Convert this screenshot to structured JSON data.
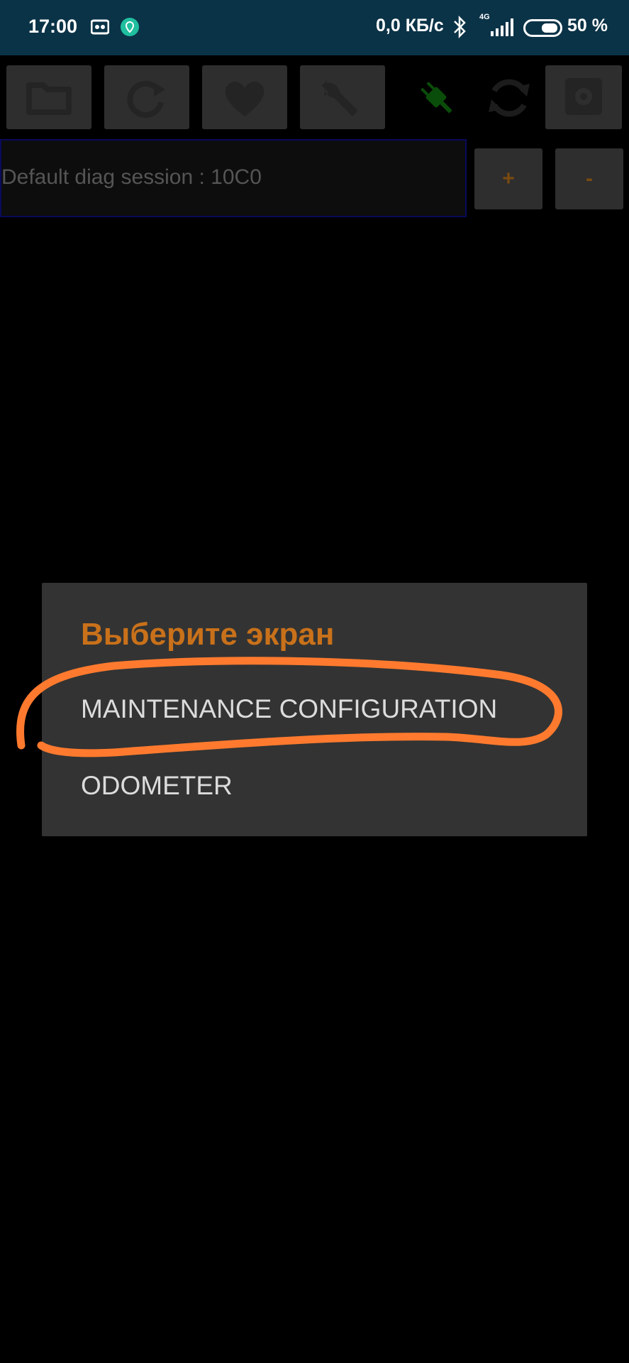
{
  "status_bar": {
    "time": "17:00",
    "network_speed": "0,0 КБ/с",
    "network_type": "4G",
    "battery": "50 %",
    "icons": [
      "vpn-card-icon",
      "location-app-icon",
      "bluetooth-icon",
      "signal-icon",
      "battery-icon"
    ]
  },
  "toolbar": {
    "icons": [
      "folder-icon",
      "refresh-icon",
      "heart-icon",
      "wrench-icon",
      "plug-icon",
      "sync-icon",
      "settings-icon"
    ]
  },
  "session": {
    "label": "Default diag session : 10C0",
    "plus_label": "+",
    "minus_label": "-"
  },
  "dialog": {
    "title": "Выберите экран",
    "items": [
      {
        "label": "MAINTENANCE CONFIGURATION"
      },
      {
        "label": "ODOMETER"
      }
    ]
  },
  "colors": {
    "status_bar_bg": "#0b3347",
    "accent": "#c9711a",
    "annotation": "#ff7a2e"
  }
}
